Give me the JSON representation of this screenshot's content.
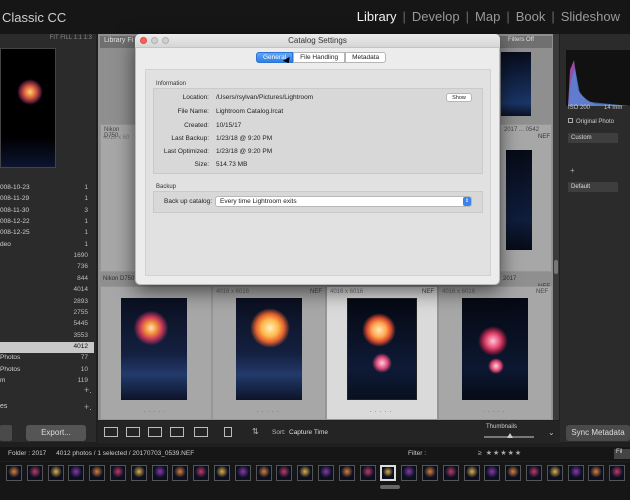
{
  "app": {
    "title": "Classic CC",
    "modules": [
      "Library",
      "Develop",
      "Map",
      "Book",
      "Slideshow"
    ],
    "active_module": "Library"
  },
  "left_panel": {
    "nav_header": "FIT  FILL  1:1  1:3",
    "catalog": [
      {
        "name": "008-10-23",
        "count": "1"
      },
      {
        "name": "008-11-29",
        "count": "1"
      },
      {
        "name": "008-11-30",
        "count": "3"
      },
      {
        "name": "008-12-22",
        "count": "1"
      },
      {
        "name": "008-12-25",
        "count": "1"
      },
      {
        "name": "deo",
        "count": "1"
      },
      {
        "name": "",
        "count": "1690"
      },
      {
        "name": "",
        "count": "736"
      },
      {
        "name": "",
        "count": "844"
      },
      {
        "name": "",
        "count": "4014"
      },
      {
        "name": "",
        "count": "2893"
      },
      {
        "name": "",
        "count": "2755"
      },
      {
        "name": "",
        "count": "5445"
      },
      {
        "name": "",
        "count": "3553"
      },
      {
        "name": "",
        "count": "4012"
      },
      {
        "name": "Photos",
        "count": "77"
      },
      {
        "name": "Photos",
        "count": "10"
      },
      {
        "name": "m",
        "count": "119"
      }
    ],
    "selected_index": 14,
    "es_label": "es",
    "export_label": "Export..."
  },
  "grid": {
    "filter_label": "Library Fi",
    "filters_off": "Filters Off",
    "row1": [
      {
        "text": "Nikon D750",
        "sub": "4016 x 60",
        "ext": ""
      },
      {
        "text": "2017 ... 0542",
        "sub": "",
        "ext": "NEF"
      }
    ],
    "row2": [
      {
        "text": "Nikon D750",
        "sub": "4016 x 60",
        "ext": ""
      },
      {
        "text": "2017",
        "sub": "",
        "ext": "NEF"
      }
    ],
    "row3_ext": [
      "NEF",
      "NEF",
      "NEF",
      "NEF"
    ],
    "row3_text": [
      "4016 x 6016",
      "4016 x 6016",
      "4016 x 6016",
      "4016 x 6016"
    ]
  },
  "right_panel": {
    "iso": "ISO 200",
    "focal": "14 mm",
    "original_photo": "Original Photo",
    "custom": "Custom",
    "default": "Default",
    "sync_label": "Sync Metadata"
  },
  "toolbar": {
    "sort_label": "Sort:",
    "sort_value": "Capture Time",
    "thumbnails_label": "Thumbnails"
  },
  "filmstrip": {
    "folder": "Folder : 2017",
    "summary": "4012 photos / 1 selected / 20170703_0539.NEF",
    "filter_label": "Filter :",
    "stars": "≥ ★★★★★",
    "fil_button": "Fil"
  },
  "dialog": {
    "title": "Catalog Settings",
    "tabs": [
      "General",
      "File Handling",
      "Metadata"
    ],
    "active_tab": "General",
    "info_section": "Information",
    "fields": [
      {
        "label": "Location:",
        "value": "/Users/rsylvan/Pictures/Lightroom"
      },
      {
        "label": "File Name:",
        "value": "Lightroom Catalog.lrcat"
      },
      {
        "label": "Created:",
        "value": "10/15/17"
      },
      {
        "label": "Last Backup:",
        "value": "1/23/18 @ 9:20 PM"
      },
      {
        "label": "Last Optimized:",
        "value": "1/23/18 @ 9:20 PM"
      },
      {
        "label": "Size:",
        "value": "514.73 MB"
      }
    ],
    "show_button": "Show",
    "backup_section": "Backup",
    "backup_label": "Back up catalog:",
    "backup_value": "Every time Lightroom exits",
    "colors": {
      "close": "#fc5f57",
      "min": "#cfcfcf",
      "max": "#cfcfcf",
      "accent": "#2e7fe8"
    }
  }
}
